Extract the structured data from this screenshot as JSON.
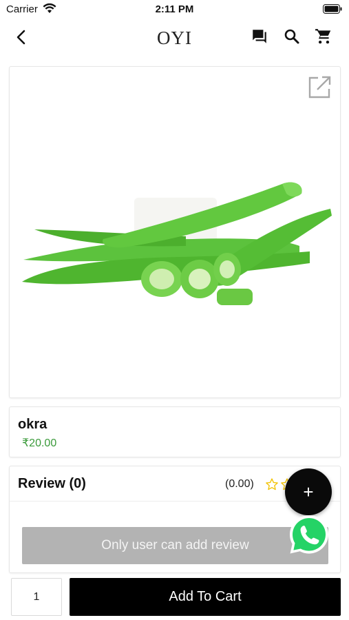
{
  "status_bar": {
    "carrier": "Carrier",
    "time": "2:11 PM"
  },
  "nav": {
    "logo": "OYI",
    "icons": [
      "back-arrow-icon",
      "chat-icon",
      "search-icon",
      "cart-icon"
    ]
  },
  "product": {
    "name": "okra",
    "price": "₹20.00",
    "image": "okra-image",
    "accent_price_color": "#3a9a3a"
  },
  "review": {
    "title": "Review (0)",
    "score": "(0.00)",
    "stars_filled": 0,
    "star_color": "#f2c200",
    "add_review_label": "Only user can add review"
  },
  "cart": {
    "quantity": "1",
    "add_to_cart_label": "Add To Cart"
  },
  "fab": {
    "plus_label": "+",
    "whatsapp_icon": "whatsapp-icon"
  }
}
